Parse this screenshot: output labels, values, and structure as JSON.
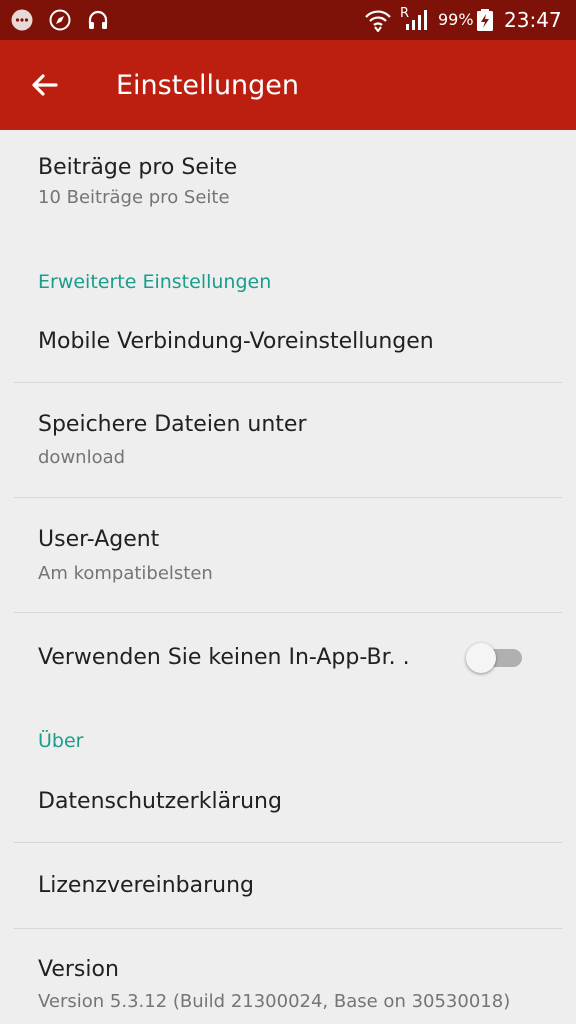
{
  "status_bar": {
    "icons": [
      "messages-icon",
      "compass-icon",
      "headphones-icon",
      "wifi-icon",
      "signal-icon",
      "battery-icon"
    ],
    "roaming": "R",
    "battery": "99%",
    "time": "23:47"
  },
  "app_bar": {
    "title": "Einstellungen",
    "accent": "#bc1f10"
  },
  "settings": {
    "posts_per_page": {
      "title": "Beiträge pro Seite",
      "subtitle": "10 Beiträge pro Seite"
    },
    "advanced_header": "Erweiterte Einstellungen",
    "mobile_connection": {
      "title": "Mobile Verbindung-Voreinstellungen"
    },
    "save_files": {
      "title": "Speichere Dateien unter",
      "subtitle": "download"
    },
    "user_agent": {
      "title": "User-Agent",
      "subtitle": "Am kompatibelsten"
    },
    "no_inapp_browser": {
      "title": "Verwenden Sie keinen In-App-Br. .",
      "toggle_on": false
    },
    "about_header": "Über",
    "privacy": {
      "title": "Datenschutzerklärung"
    },
    "license": {
      "title": "Lizenzvereinbarung"
    },
    "version": {
      "title": "Version",
      "subtitle": "Version 5.3.12 (Build 21300024, Base on 30530018)"
    }
  },
  "colors": {
    "status_bar": "#7f1208",
    "section_header": "#1a9d8a",
    "background": "#eeeeee"
  }
}
